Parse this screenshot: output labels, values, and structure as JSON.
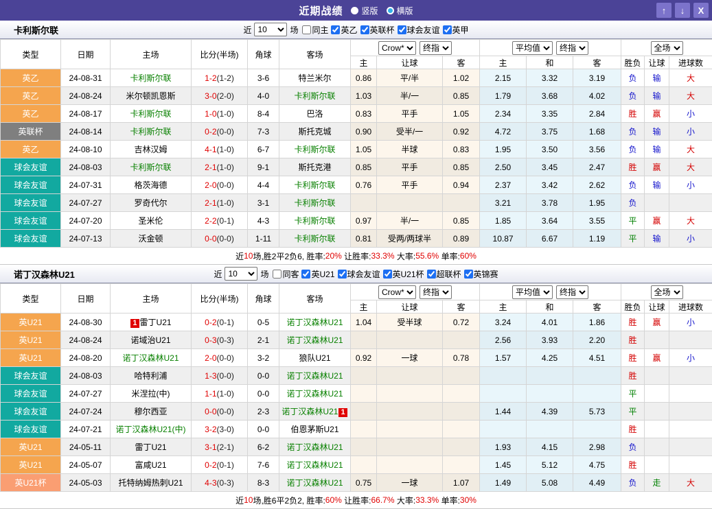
{
  "titlebar": {
    "title": "近期战绩",
    "view_options": [
      {
        "label": "竖版",
        "selected": true
      },
      {
        "label": "横版",
        "selected": false
      }
    ],
    "buttons": {
      "up": "↑",
      "down": "↓",
      "close": "X"
    }
  },
  "filter": {
    "prefix": "近",
    "matches": "10",
    "suffix": "场"
  },
  "header_row": {
    "main_cols": [
      "类型",
      "日期",
      "主场",
      "比分(半场)",
      "角球",
      "客场"
    ],
    "odds_selects": [
      "Crow*",
      "终指"
    ],
    "avg_selects": [
      "平均值",
      "终指"
    ],
    "result_selects": [
      "全场"
    ],
    "sub_cols": [
      "主",
      "让球",
      "客",
      "主",
      "和",
      "客",
      "胜负",
      "让球",
      "进球数"
    ]
  },
  "colors": {
    "titlebar": "#4B4397",
    "titlebar_button": "#7C73CB",
    "league_orange": "#F5A54E",
    "league_gray": "#7F7F7F",
    "league_teal": "#12A9A0",
    "league_salmon": "#FA9E72",
    "team_highlight_green": "#088000",
    "score_red": "#E00000",
    "result_red": "#D40000",
    "result_blue": "#1414CC",
    "result_green": "#008000",
    "checkbox_blue": "#1D6FF2",
    "crow_col_bg": "#FDF6EC",
    "avg_col_bg": "#E9F6FB"
  },
  "tables": [
    {
      "team": "卡利斯尔联",
      "same_venue_label": "同主",
      "leagues": [
        "英乙",
        "英联杯",
        "球会友谊",
        "英甲"
      ],
      "rows": [
        {
          "type": "英乙",
          "type_color": "orange",
          "date": "24-08-31",
          "home": {
            "text": "卡利斯尔联",
            "highlight": true
          },
          "score": "1-2",
          "half": "(1-2)",
          "corner": "3-6",
          "away": {
            "text": "特兰米尔",
            "highlight": false
          },
          "odds": [
            "0.86",
            "平/半",
            "1.02"
          ],
          "avg": [
            "2.15",
            "3.32",
            "3.19"
          ],
          "results": [
            [
              "负",
              "blue"
            ],
            [
              "输",
              "blue"
            ],
            [
              "大",
              "red"
            ]
          ]
        },
        {
          "type": "英乙",
          "type_color": "orange",
          "date": "24-08-24",
          "home": {
            "text": "米尔顿凯恩斯",
            "highlight": false
          },
          "score": "3-0",
          "half": "(2-0)",
          "corner": "4-0",
          "away": {
            "text": "卡利斯尔联",
            "highlight": true
          },
          "odds": [
            "1.03",
            "半/一",
            "0.85"
          ],
          "avg": [
            "1.79",
            "3.68",
            "4.02"
          ],
          "results": [
            [
              "负",
              "blue"
            ],
            [
              "输",
              "blue"
            ],
            [
              "大",
              "red"
            ]
          ]
        },
        {
          "type": "英乙",
          "type_color": "orange",
          "date": "24-08-17",
          "home": {
            "text": "卡利斯尔联",
            "highlight": true
          },
          "score": "1-0",
          "half": "(1-0)",
          "corner": "8-4",
          "away": {
            "text": "巴洛",
            "highlight": false
          },
          "odds": [
            "0.83",
            "平手",
            "1.05"
          ],
          "avg": [
            "2.34",
            "3.35",
            "2.84"
          ],
          "results": [
            [
              "胜",
              "red"
            ],
            [
              "赢",
              "red"
            ],
            [
              "小",
              "blue"
            ]
          ]
        },
        {
          "type": "英联杯",
          "type_color": "gray",
          "date": "24-08-14",
          "home": {
            "text": "卡利斯尔联",
            "highlight": true
          },
          "score": "0-2",
          "half": "(0-0)",
          "corner": "7-3",
          "away": {
            "text": "斯托克城",
            "highlight": false
          },
          "odds": [
            "0.90",
            "受半/一",
            "0.92"
          ],
          "avg": [
            "4.72",
            "3.75",
            "1.68"
          ],
          "results": [
            [
              "负",
              "blue"
            ],
            [
              "输",
              "blue"
            ],
            [
              "小",
              "blue"
            ]
          ]
        },
        {
          "type": "英乙",
          "type_color": "orange",
          "date": "24-08-10",
          "home": {
            "text": "吉林汉姆",
            "highlight": false
          },
          "score": "4-1",
          "half": "(1-0)",
          "corner": "6-7",
          "away": {
            "text": "卡利斯尔联",
            "highlight": true
          },
          "odds": [
            "1.05",
            "半球",
            "0.83"
          ],
          "avg": [
            "1.95",
            "3.50",
            "3.56"
          ],
          "results": [
            [
              "负",
              "blue"
            ],
            [
              "输",
              "blue"
            ],
            [
              "大",
              "red"
            ]
          ]
        },
        {
          "type": "球会友谊",
          "type_color": "teal",
          "date": "24-08-03",
          "home": {
            "text": "卡利斯尔联",
            "highlight": true
          },
          "score": "2-1",
          "half": "(1-0)",
          "corner": "9-1",
          "away": {
            "text": "斯托克港",
            "highlight": false
          },
          "odds": [
            "0.85",
            "平手",
            "0.85"
          ],
          "avg": [
            "2.50",
            "3.45",
            "2.47"
          ],
          "results": [
            [
              "胜",
              "red"
            ],
            [
              "赢",
              "red"
            ],
            [
              "大",
              "red"
            ]
          ]
        },
        {
          "type": "球会友谊",
          "type_color": "teal",
          "date": "24-07-31",
          "home": {
            "text": "格茨海德",
            "highlight": false
          },
          "score": "2-0",
          "half": "(0-0)",
          "corner": "4-4",
          "away": {
            "text": "卡利斯尔联",
            "highlight": true
          },
          "odds": [
            "0.76",
            "平手",
            "0.94"
          ],
          "avg": [
            "2.37",
            "3.42",
            "2.62"
          ],
          "results": [
            [
              "负",
              "blue"
            ],
            [
              "输",
              "blue"
            ],
            [
              "小",
              "blue"
            ]
          ]
        },
        {
          "type": "球会友谊",
          "type_color": "teal",
          "date": "24-07-27",
          "home": {
            "text": "罗奇代尔",
            "highlight": false
          },
          "score": "2-1",
          "half": "(1-0)",
          "corner": "3-1",
          "away": {
            "text": "卡利斯尔联",
            "highlight": true
          },
          "odds": [
            "",
            "",
            ""
          ],
          "avg": [
            "3.21",
            "3.78",
            "1.95"
          ],
          "results": [
            [
              "负",
              "blue"
            ],
            [
              "",
              ""
            ],
            [
              "",
              ""
            ]
          ]
        },
        {
          "type": "球会友谊",
          "type_color": "teal",
          "date": "24-07-20",
          "home": {
            "text": "圣米伦",
            "highlight": false
          },
          "score": "2-2",
          "half": "(0-1)",
          "corner": "4-3",
          "away": {
            "text": "卡利斯尔联",
            "highlight": true
          },
          "odds": [
            "0.97",
            "半/一",
            "0.85"
          ],
          "avg": [
            "1.85",
            "3.64",
            "3.55"
          ],
          "results": [
            [
              "平",
              "green"
            ],
            [
              "赢",
              "red"
            ],
            [
              "大",
              "red"
            ]
          ]
        },
        {
          "type": "球会友谊",
          "type_color": "teal",
          "date": "24-07-13",
          "home": {
            "text": "沃金顿",
            "highlight": false
          },
          "score": "0-0",
          "half": "(0-0)",
          "corner": "1-11",
          "away": {
            "text": "卡利斯尔联",
            "highlight": true
          },
          "odds": [
            "0.81",
            "受两/两球半",
            "0.89"
          ],
          "avg": [
            "10.87",
            "6.67",
            "1.19"
          ],
          "results": [
            [
              "平",
              "green"
            ],
            [
              "输",
              "blue"
            ],
            [
              "小",
              "blue"
            ]
          ]
        }
      ],
      "summary": [
        [
          "近",
          "k"
        ],
        [
          "10",
          "r"
        ],
        [
          "场,胜2平2负6, 胜率:",
          "k"
        ],
        [
          "20%",
          "r"
        ],
        [
          " 让胜率:",
          "k"
        ],
        [
          "33.3%",
          "r"
        ],
        [
          " 大率:",
          "k"
        ],
        [
          "55.6%",
          "r"
        ],
        [
          " 单率:",
          "k"
        ],
        [
          "60%",
          "r"
        ]
      ]
    },
    {
      "team": "诺丁汉森林U21",
      "same_venue_label": "同客",
      "leagues": [
        "英U21",
        "球会友谊",
        "英U21杯",
        "超联杯",
        "英锦赛"
      ],
      "rows": [
        {
          "type": "英U21",
          "type_color": "orange",
          "date": "24-08-30",
          "home": {
            "text": "雷丁U21",
            "highlight": false,
            "badge_before": "1"
          },
          "score": "0-2",
          "half": "(0-1)",
          "corner": "0-5",
          "away": {
            "text": "诺丁汉森林U21",
            "highlight": true
          },
          "odds": [
            "1.04",
            "受半球",
            "0.72"
          ],
          "avg": [
            "3.24",
            "4.01",
            "1.86"
          ],
          "results": [
            [
              "胜",
              "red"
            ],
            [
              "赢",
              "red"
            ],
            [
              "小",
              "blue"
            ]
          ]
        },
        {
          "type": "英U21",
          "type_color": "orange",
          "date": "24-08-24",
          "home": {
            "text": "诺域治U21",
            "highlight": false
          },
          "score": "0-3",
          "half": "(0-3)",
          "corner": "2-1",
          "away": {
            "text": "诺丁汉森林U21",
            "highlight": true
          },
          "odds": [
            "",
            "",
            ""
          ],
          "avg": [
            "2.56",
            "3.93",
            "2.20"
          ],
          "results": [
            [
              "胜",
              "red"
            ],
            [
              "",
              ""
            ],
            [
              "",
              ""
            ]
          ]
        },
        {
          "type": "英U21",
          "type_color": "orange",
          "date": "24-08-20",
          "home": {
            "text": "诺丁汉森林U21",
            "highlight": true
          },
          "score": "2-0",
          "half": "(0-0)",
          "corner": "3-2",
          "away": {
            "text": "狼队U21",
            "highlight": false
          },
          "odds": [
            "0.92",
            "一球",
            "0.78"
          ],
          "avg": [
            "1.57",
            "4.25",
            "4.51"
          ],
          "results": [
            [
              "胜",
              "red"
            ],
            [
              "赢",
              "red"
            ],
            [
              "小",
              "blue"
            ]
          ]
        },
        {
          "type": "球会友谊",
          "type_color": "teal",
          "date": "24-08-03",
          "home": {
            "text": "哈特利浦",
            "highlight": false
          },
          "score": "1-3",
          "half": "(0-0)",
          "corner": "0-0",
          "away": {
            "text": "诺丁汉森林U21",
            "highlight": true
          },
          "odds": [
            "",
            "",
            ""
          ],
          "avg": [
            "",
            "",
            ""
          ],
          "results": [
            [
              "胜",
              "red"
            ],
            [
              "",
              ""
            ],
            [
              "",
              ""
            ]
          ]
        },
        {
          "type": "球会友谊",
          "type_color": "teal",
          "date": "24-07-27",
          "home": {
            "text": "米涅拉(中)",
            "highlight": false
          },
          "score": "1-1",
          "half": "(1-0)",
          "corner": "0-0",
          "away": {
            "text": "诺丁汉森林U21",
            "highlight": true
          },
          "odds": [
            "",
            "",
            ""
          ],
          "avg": [
            "",
            "",
            ""
          ],
          "results": [
            [
              "平",
              "green"
            ],
            [
              "",
              ""
            ],
            [
              "",
              ""
            ]
          ]
        },
        {
          "type": "球会友谊",
          "type_color": "teal",
          "date": "24-07-24",
          "home": {
            "text": "穆尔西亚",
            "highlight": false
          },
          "score": "0-0",
          "half": "(0-0)",
          "corner": "2-3",
          "away": {
            "text": "诺丁汉森林U21",
            "highlight": true,
            "badge_after": "1"
          },
          "odds": [
            "",
            "",
            ""
          ],
          "avg": [
            "1.44",
            "4.39",
            "5.73"
          ],
          "results": [
            [
              "平",
              "green"
            ],
            [
              "",
              ""
            ],
            [
              "",
              ""
            ]
          ]
        },
        {
          "type": "球会友谊",
          "type_color": "teal",
          "date": "24-07-21",
          "home": {
            "text": "诺丁汉森林U21(中)",
            "highlight": true
          },
          "score": "3-2",
          "half": "(3-0)",
          "corner": "0-0",
          "away": {
            "text": "伯恩茅斯U21",
            "highlight": false
          },
          "odds": [
            "",
            "",
            ""
          ],
          "avg": [
            "",
            "",
            ""
          ],
          "results": [
            [
              "胜",
              "red"
            ],
            [
              "",
              ""
            ],
            [
              "",
              ""
            ]
          ]
        },
        {
          "type": "英U21",
          "type_color": "orange",
          "date": "24-05-11",
          "home": {
            "text": "雷丁U21",
            "highlight": false
          },
          "score": "3-1",
          "half": "(2-1)",
          "corner": "6-2",
          "away": {
            "text": "诺丁汉森林U21",
            "highlight": true
          },
          "odds": [
            "",
            "",
            ""
          ],
          "avg": [
            "1.93",
            "4.15",
            "2.98"
          ],
          "results": [
            [
              "负",
              "blue"
            ],
            [
              "",
              ""
            ],
            [
              "",
              ""
            ]
          ]
        },
        {
          "type": "英U21",
          "type_color": "orange",
          "date": "24-05-07",
          "home": {
            "text": "富咸U21",
            "highlight": false
          },
          "score": "0-2",
          "half": "(0-1)",
          "corner": "7-6",
          "away": {
            "text": "诺丁汉森林U21",
            "highlight": true
          },
          "odds": [
            "",
            "",
            ""
          ],
          "avg": [
            "1.45",
            "5.12",
            "4.75"
          ],
          "results": [
            [
              "胜",
              "red"
            ],
            [
              "",
              ""
            ],
            [
              "",
              ""
            ]
          ]
        },
        {
          "type": "英U21杯",
          "type_color": "salmon",
          "date": "24-05-03",
          "home": {
            "text": "托特纳姆热刺U21",
            "highlight": false
          },
          "score": "4-3",
          "half": "(0-3)",
          "corner": "8-3",
          "away": {
            "text": "诺丁汉森林U21",
            "highlight": true
          },
          "odds": [
            "0.75",
            "一球",
            "1.07"
          ],
          "avg": [
            "1.49",
            "5.08",
            "4.49"
          ],
          "results": [
            [
              "负",
              "blue"
            ],
            [
              "走",
              "green"
            ],
            [
              "大",
              "red"
            ]
          ]
        }
      ],
      "summary": [
        [
          "近",
          "k"
        ],
        [
          "10",
          "r"
        ],
        [
          "场,胜6平2负2, 胜率:",
          "k"
        ],
        [
          "60%",
          "r"
        ],
        [
          " 让胜率:",
          "k"
        ],
        [
          "66.7%",
          "r"
        ],
        [
          " 大率:",
          "k"
        ],
        [
          "33.3%",
          "r"
        ],
        [
          " 单率:",
          "k"
        ],
        [
          "30%",
          "r"
        ]
      ]
    }
  ]
}
